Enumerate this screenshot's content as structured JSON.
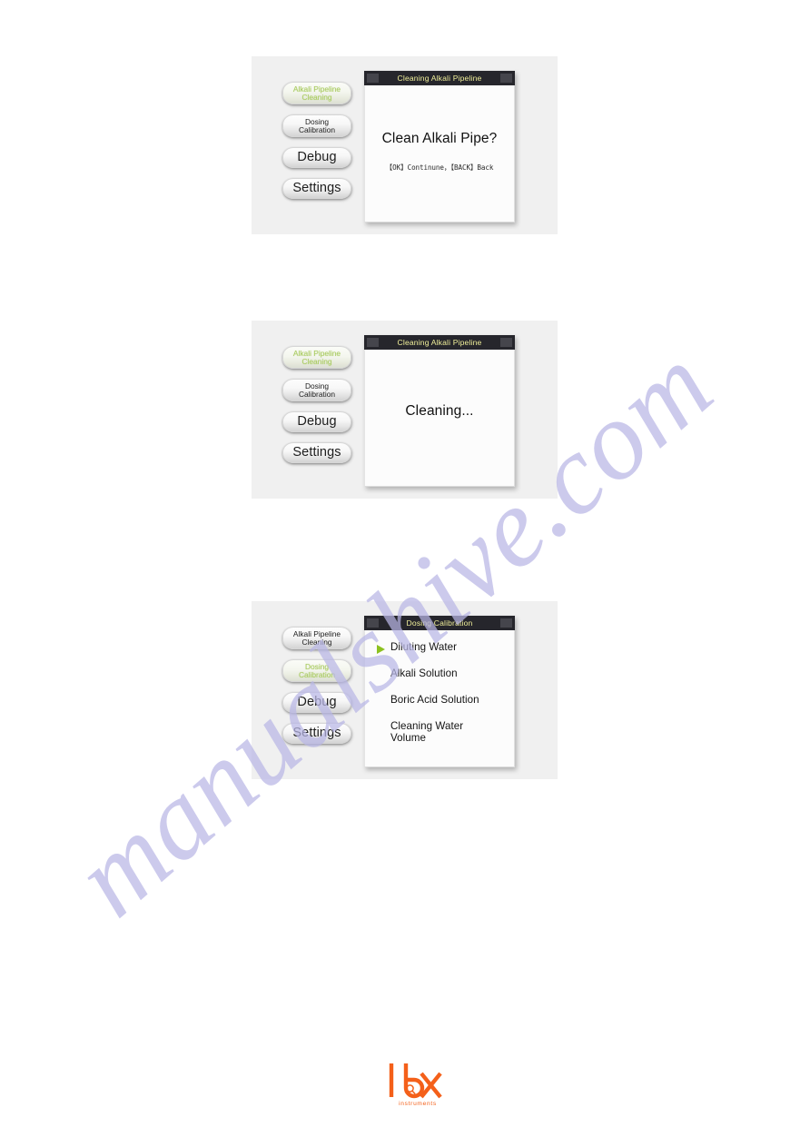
{
  "brand": {
    "logo_wordmark": "lbx",
    "logo_tagline": "instruments",
    "logo_color": "#f4601a",
    "logo_icon": "magnifier-icon"
  },
  "watermark": {
    "text": "manualshive.com",
    "color": "#b9b7e6"
  },
  "theme": {
    "panel_background": "#f0f0f0",
    "titlebar_background": "#26262c",
    "titlebar_text": "#f0ef9a",
    "selected_button_text": "#a9cb60",
    "cursor_arrow": "#8cc11f",
    "lcd_background": "#fcfcfc"
  },
  "screens": [
    {
      "id": "screen-clean-confirm",
      "titlebar": {
        "title": "Cleaning Alkali Pipeline",
        "left_box": "titlebar-left-box",
        "right_box": "titlebar-right-box"
      },
      "sidebar": {
        "items": [
          {
            "label_line1": "Alkali Pipeline",
            "label_line2": "Cleaning",
            "name": "sidebar-item-alkali-pipeline-cleaning",
            "selected": true,
            "lines": 2
          },
          {
            "label_line1": "Dosing",
            "label_line2": "Calibration",
            "name": "sidebar-item-dosing-calibration",
            "selected": false,
            "lines": 2
          },
          {
            "label_line1": "Debug",
            "label_line2": "",
            "name": "sidebar-item-debug",
            "selected": false,
            "lines": 1
          },
          {
            "label_line1": "Settings",
            "label_line2": "",
            "name": "sidebar-item-settings",
            "selected": false,
            "lines": 1
          }
        ]
      },
      "body": {
        "type": "confirm",
        "question": "Clean Alkali Pipe?",
        "hint": "【OK】Continune，【BACK】Back"
      }
    },
    {
      "id": "screen-cleaning-busy",
      "titlebar": {
        "title": "Cleaning Alkali Pipeline",
        "left_box": "titlebar-left-box",
        "right_box": "titlebar-right-box"
      },
      "sidebar": {
        "items": [
          {
            "label_line1": "Alkali Pipeline",
            "label_line2": "Cleaning",
            "name": "sidebar-item-alkali-pipeline-cleaning",
            "selected": true,
            "lines": 2
          },
          {
            "label_line1": "Dosing",
            "label_line2": "Calibration",
            "name": "sidebar-item-dosing-calibration",
            "selected": false,
            "lines": 2
          },
          {
            "label_line1": "Debug",
            "label_line2": "",
            "name": "sidebar-item-debug",
            "selected": false,
            "lines": 1
          },
          {
            "label_line1": "Settings",
            "label_line2": "",
            "name": "sidebar-item-settings",
            "selected": false,
            "lines": 1
          }
        ]
      },
      "body": {
        "type": "status",
        "status": "Cleaning..."
      }
    },
    {
      "id": "screen-dosing-calibration-menu",
      "titlebar": {
        "title": "Dosing Calibration",
        "left_box": "titlebar-left-box",
        "right_box": "titlebar-right-box"
      },
      "sidebar": {
        "items": [
          {
            "label_line1": "Alkali Pipeline",
            "label_line2": "Cleaning",
            "name": "sidebar-item-alkali-pipeline-cleaning",
            "selected": false,
            "lines": 2
          },
          {
            "label_line1": "Dosing",
            "label_line2": "Calibration",
            "name": "sidebar-item-dosing-calibration",
            "selected": true,
            "lines": 2
          },
          {
            "label_line1": "Debug",
            "label_line2": "",
            "name": "sidebar-item-debug",
            "selected": false,
            "lines": 1
          },
          {
            "label_line1": "Settings",
            "label_line2": "",
            "name": "sidebar-item-settings",
            "selected": false,
            "lines": 1
          }
        ]
      },
      "body": {
        "type": "menu",
        "items": [
          {
            "label_line1": "Diluting Water",
            "label_line2": "",
            "name": "menu-item-diluting-water",
            "selected": true
          },
          {
            "label_line1": "Alkali Solution",
            "label_line2": "",
            "name": "menu-item-alkali-solution",
            "selected": false
          },
          {
            "label_line1": "Boric Acid Solution",
            "label_line2": "",
            "name": "menu-item-boric-acid-solution",
            "selected": false
          },
          {
            "label_line1": "Cleaning Water",
            "label_line2": "Volume",
            "name": "menu-item-cleaning-water-volume",
            "selected": false
          }
        ]
      }
    }
  ]
}
